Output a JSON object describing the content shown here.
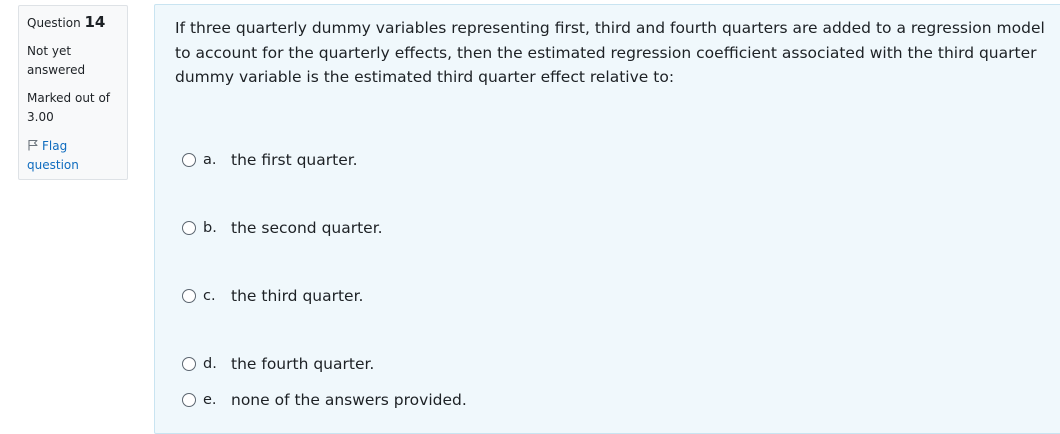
{
  "question_info": {
    "label": "Question",
    "number": "14",
    "state": "Not yet answered",
    "grade": "Marked out of 3.00",
    "flag_label": "Flag question"
  },
  "question": {
    "text": "If three quarterly dummy variables representing first, third and fourth quarters are added to a regression model to account for the quarterly effects, then the estimated regression coefficient associated with the third quarter dummy variable is the estimated third quarter effect relative to:",
    "answers": [
      {
        "letter": "a.",
        "text": "the first quarter."
      },
      {
        "letter": "b.",
        "text": "the second quarter."
      },
      {
        "letter": "c.",
        "text": "the third quarter."
      },
      {
        "letter": "d.",
        "text": "the fourth quarter."
      },
      {
        "letter": "e.",
        "text": "none of the answers provided."
      }
    ]
  },
  "icons": {
    "flag": "flag-icon",
    "radio": "radio-unchecked-icon"
  },
  "colors": {
    "link": "#0f6cbf",
    "content_bg": "#f0f8fc",
    "content_border": "#c9e4f1",
    "info_bg": "#f8f9fa"
  }
}
